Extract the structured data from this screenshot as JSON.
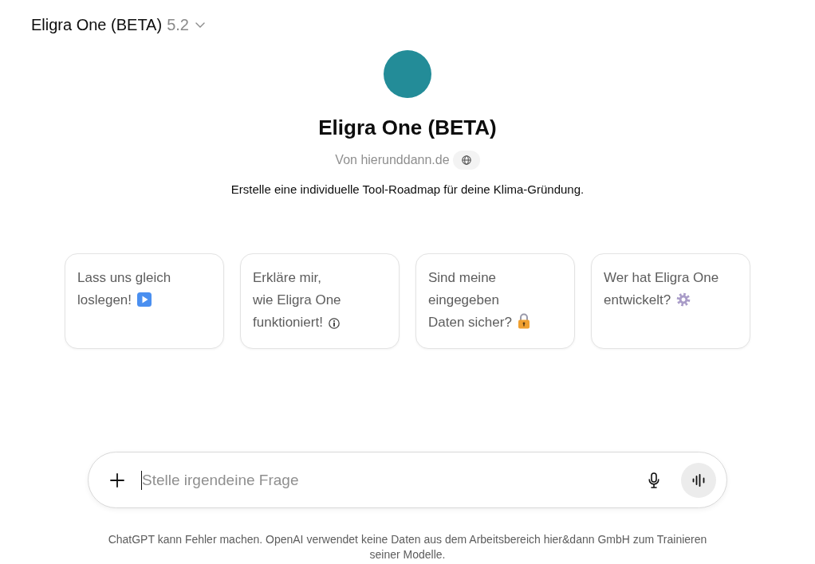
{
  "header": {
    "title": "Eligra One (BETA)",
    "version": "5.2"
  },
  "profile": {
    "name": "Eligra One (BETA)",
    "author": "Von hierunddann.de",
    "description": "Erstelle eine individuelle Tool-Roadmap für deine Klima-Gründung."
  },
  "suggestions": [
    {
      "text": "Lass uns gleich loslegen!"
    },
    {
      "text": "Erkläre mir,\nwie Eligra One funktioniert!"
    },
    {
      "text": "Sind meine eingegeben\nDaten sicher?"
    },
    {
      "text": "Wer hat Eligra One entwickelt?"
    }
  ],
  "composer": {
    "placeholder": "Stelle irgendeine Frage"
  },
  "disclaimer": "ChatGPT kann Fehler machen. OpenAI verwendet keine Daten aus dem Arbeitsbereich hier&dann GmbH zum Trainieren seiner Modelle."
}
